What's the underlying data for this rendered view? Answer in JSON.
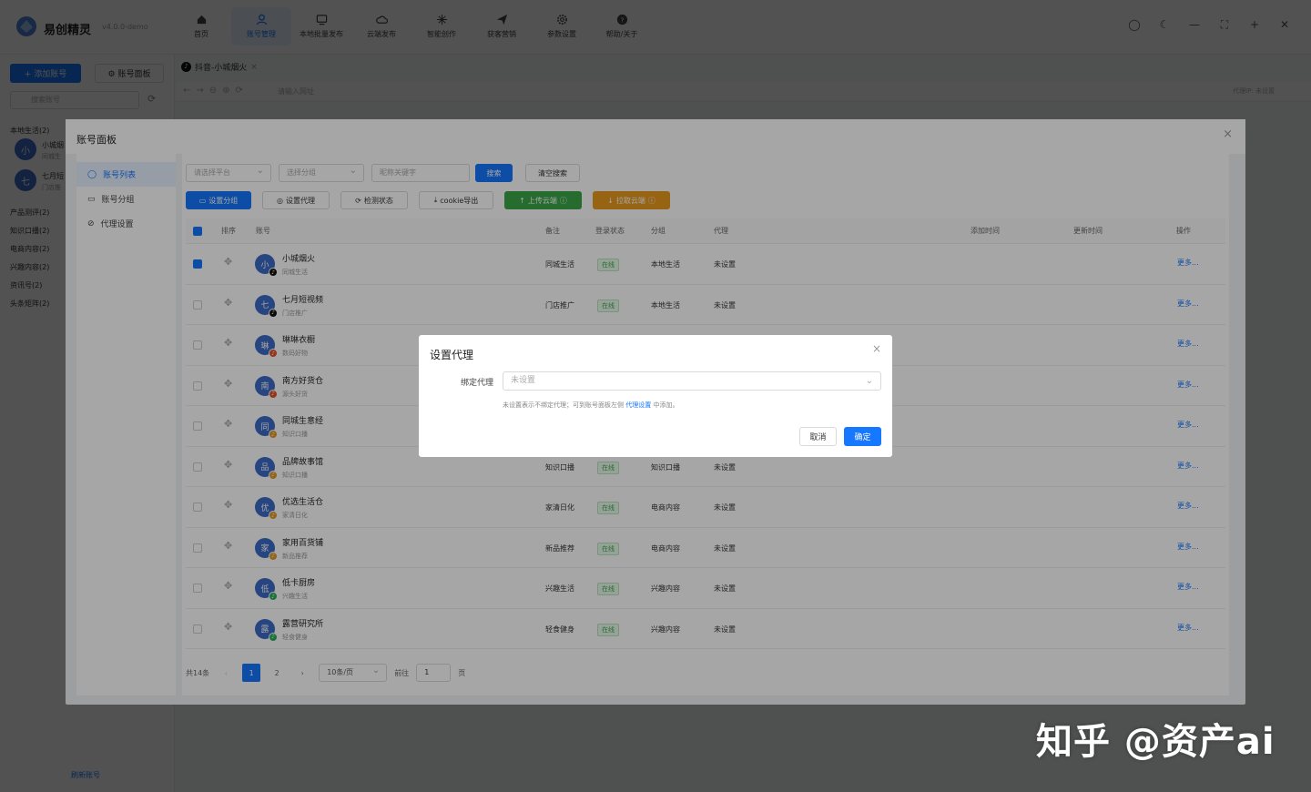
{
  "app": {
    "name": "易创精灵",
    "version": "v4.0.0-demo"
  },
  "nav": [
    {
      "label": "首页",
      "icon": "home-icon"
    },
    {
      "label": "账号管理",
      "icon": "user-icon",
      "active": true
    },
    {
      "label": "本地批量发布",
      "icon": "monitor-icon"
    },
    {
      "label": "云端发布",
      "icon": "cloud-icon"
    },
    {
      "label": "智能创作",
      "icon": "sparkle-icon"
    },
    {
      "label": "获客营销",
      "icon": "send-icon"
    },
    {
      "label": "参数设置",
      "icon": "gear-icon"
    },
    {
      "label": "帮助/关于",
      "icon": "help-icon"
    }
  ],
  "sidebar": {
    "add_label": "+ 添加账号",
    "panel_label": "⚙ 账号面板",
    "search_placeholder": "搜索账号",
    "groups": [
      "本地生活(2)",
      "产品测评(2)",
      "知识口播(2)",
      "电商内容(2)",
      "兴趣内容(2)",
      "资讯号(2)",
      "头条矩阵(2)"
    ],
    "accounts": [
      {
        "avatar": "小",
        "name": "小城烟",
        "sub": "同城生"
      },
      {
        "avatar": "七",
        "name": "七月短",
        "sub": "门店推"
      }
    ],
    "bottom_link": "刷新账号"
  },
  "tab": {
    "label": "抖音-小城烟火",
    "close": "×"
  },
  "urlbar": {
    "placeholder": "请输入网址",
    "proxy": "代理IP: 未设置"
  },
  "panel": {
    "title": "账号面板",
    "menu": [
      {
        "label": "账号列表",
        "icon": "user-icon",
        "active": true
      },
      {
        "label": "账号分组",
        "icon": "folder-icon"
      },
      {
        "label": "代理设置",
        "icon": "link-icon"
      }
    ],
    "filters": {
      "platform_placeholder": "请选择平台",
      "group_placeholder": "选择分组",
      "keyword_placeholder": "昵称关键字",
      "search_label": "搜索",
      "clear_label": "清空搜索"
    },
    "actions": {
      "set_group": "设置分组",
      "set_proxy": "设置代理",
      "check_status": "检测状态",
      "cookie_export": "cookie导出",
      "upload_cloud": "上传云端",
      "pull_cloud": "拉取云端"
    },
    "columns": {
      "sort": "排序",
      "account": "账号",
      "note": "备注",
      "login": "登录状态",
      "group": "分组",
      "proxy": "代理",
      "added": "添加时间",
      "updated": "更新时间",
      "ops": "操作"
    },
    "rows": [
      {
        "avatar": "小",
        "name": "小城烟火",
        "sub": "同城生活",
        "note": "同城生活",
        "status": "在线",
        "group": "本地生活",
        "proxy": "未设置",
        "checked": true
      },
      {
        "avatar": "七",
        "name": "七月短视频",
        "sub": "门店推广",
        "note": "门店推广",
        "status": "在线",
        "group": "本地生活",
        "proxy": "未设置"
      },
      {
        "avatar": "琳",
        "name": "琳琳衣橱",
        "sub": "数码好物",
        "note": "",
        "status": "",
        "group": "",
        "proxy": ""
      },
      {
        "avatar": "南",
        "name": "南方好货仓",
        "sub": "源头好货",
        "note": "",
        "status": "",
        "group": "",
        "proxy": ""
      },
      {
        "avatar": "同",
        "name": "同城生意经",
        "sub": "知识口播",
        "note": "",
        "status": "",
        "group": "",
        "proxy": ""
      },
      {
        "avatar": "品",
        "name": "品牌故事馆",
        "sub": "知识口播",
        "note": "知识口播",
        "status": "在线",
        "group": "知识口播",
        "proxy": "未设置"
      },
      {
        "avatar": "优",
        "name": "优选生活仓",
        "sub": "家清日化",
        "note": "家清日化",
        "status": "在线",
        "group": "电商内容",
        "proxy": "未设置"
      },
      {
        "avatar": "家",
        "name": "家用百货铺",
        "sub": "新品推荐",
        "note": "新品推荐",
        "status": "在线",
        "group": "电商内容",
        "proxy": "未设置"
      },
      {
        "avatar": "低",
        "name": "低卡厨房",
        "sub": "兴趣生活",
        "note": "兴趣生活",
        "status": "在线",
        "group": "兴趣内容",
        "proxy": "未设置"
      },
      {
        "avatar": "露",
        "name": "露营研究所",
        "sub": "轻食健身",
        "note": "轻食健身",
        "status": "在线",
        "group": "兴趣内容",
        "proxy": "未设置"
      }
    ],
    "more_label": "更多...",
    "pager": {
      "total": "共14条",
      "pages": [
        "1",
        "2"
      ],
      "size": "10条/页",
      "goto": "前往",
      "page_value": "1",
      "page_unit": "页"
    }
  },
  "modal": {
    "title": "设置代理",
    "label": "绑定代理",
    "select_value": "未设置",
    "hint_before": "未设置表示不绑定代理；可到账号面板左侧",
    "hint_link": "代理设置",
    "hint_after": "中添加。",
    "cancel": "取消",
    "ok": "确定"
  },
  "watermark": "知乎 @资产ai"
}
